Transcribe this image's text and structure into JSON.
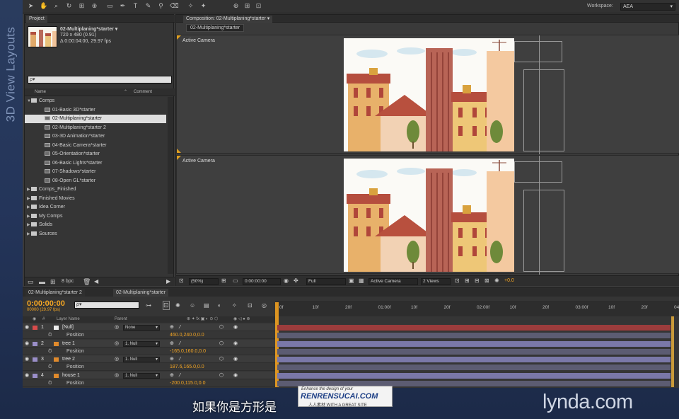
{
  "side_label": "3D View Layouts",
  "workspace": {
    "label": "Workspace:",
    "value": "AEA"
  },
  "project": {
    "tab": "Project",
    "comp_name": "02-Multiplaning*starter ▾",
    "comp_size": "720 x 480 (0.91)",
    "comp_duration": "Δ 0:00:04:00, 29.97 fps",
    "search_placeholder": "ρ▾",
    "col_name": "Name",
    "col_comment": "Comment",
    "tree": [
      {
        "label": "Comps",
        "kind": "folder",
        "indent": 0,
        "open": true
      },
      {
        "label": "01-Basic 3D*starter",
        "kind": "comp",
        "indent": 1
      },
      {
        "label": "02-Multiplaning*starter",
        "kind": "comp",
        "indent": 1,
        "selected": true
      },
      {
        "label": "02-Multiplaning*starter 2",
        "kind": "comp",
        "indent": 1
      },
      {
        "label": "03-3D Animation*starter",
        "kind": "comp",
        "indent": 1
      },
      {
        "label": "04-Basic Camera*starter",
        "kind": "comp",
        "indent": 1
      },
      {
        "label": "05-Orientation*starter",
        "kind": "comp",
        "indent": 1
      },
      {
        "label": "06-Basic Lights*starter",
        "kind": "comp",
        "indent": 1
      },
      {
        "label": "07-Shadows*starter",
        "kind": "comp",
        "indent": 1
      },
      {
        "label": "08-Open GL*starter",
        "kind": "comp",
        "indent": 1
      },
      {
        "label": "Comps_Finished",
        "kind": "folder",
        "indent": 0
      },
      {
        "label": "Finished Movies",
        "kind": "folder",
        "indent": 0
      },
      {
        "label": "Idea Corner",
        "kind": "folder",
        "indent": 0
      },
      {
        "label": "My Comps",
        "kind": "folder",
        "indent": 0
      },
      {
        "label": "Solids",
        "kind": "folder",
        "indent": 0
      },
      {
        "label": "Sources",
        "kind": "folder",
        "indent": 0
      }
    ],
    "bpc": "8 bpc"
  },
  "composition": {
    "tab": "Composition: 02-Multiplaning*starter ▾",
    "crumb": "02-Multiplaning*starter",
    "view_top_label": "Active Camera",
    "view_bottom_label": "Active Camera",
    "zoom": "(50%)",
    "time": "0:00:00:00",
    "resolution": "Full",
    "camera": "Active Camera",
    "views": "2 Views",
    "exposure": "+0.0"
  },
  "timeline": {
    "tabs": [
      "02-Multiplaning*starter 2",
      "02-Multiplaning*starter"
    ],
    "timecode": "0:00:00:00",
    "fps": "00000 (29.97 fps)",
    "col_hash": "#",
    "col_layer": "Layer Name",
    "col_parent": "Parent",
    "ruler": [
      "0f",
      "10f",
      "20f",
      "01:00f",
      "10f",
      "20f",
      "02:00f",
      "10f",
      "20f",
      "03:00f",
      "10f",
      "20f",
      "04:0"
    ],
    "layers": [
      {
        "num": "1",
        "name": "[Null]",
        "parent": "None",
        "prop": "Position",
        "value": "460.0,240.0,0.0",
        "label_color": "#d94b4b"
      },
      {
        "num": "2",
        "name": "tree 1",
        "parent": "1. Null",
        "prop": "Position",
        "value": "-165.0,160.0,0.0",
        "label_color": "#9a8ec8"
      },
      {
        "num": "3",
        "name": "tree 2",
        "parent": "1. Null",
        "prop": "Position",
        "value": "187.6,165.0,0.0",
        "label_color": "#9a8ec8"
      },
      {
        "num": "4",
        "name": "house 1",
        "parent": "1. Null",
        "prop": "Position",
        "value": "-200.0,115.0,0.0",
        "label_color": "#9a8ec8"
      }
    ]
  },
  "subtitle": "如果你是方形是",
  "logo": "lynda.com",
  "watermark": {
    "line1": "Enhance the design of your",
    "brand": "RENRENSUCAI.COM",
    "line2": "人人素材 WITH A GREAT SITE"
  }
}
